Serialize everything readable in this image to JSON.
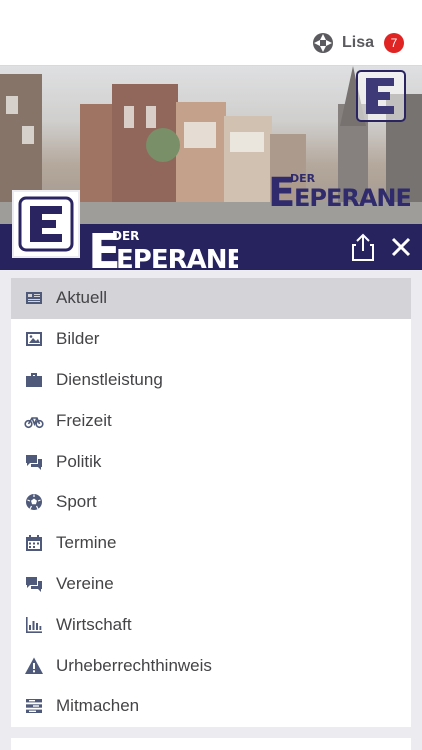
{
  "header": {
    "user_name": "Lisa",
    "notification_count": "7"
  },
  "brand": {
    "logo_letter": "E",
    "wordmark_small": "DER",
    "wordmark_big": "EPERANER",
    "primary_color": "#27235f"
  },
  "menu": {
    "items": [
      {
        "label": "Aktuell",
        "icon": "newspaper-icon"
      },
      {
        "label": "Bilder",
        "icon": "image-icon"
      },
      {
        "label": "Dienstleistung",
        "icon": "briefcase-icon"
      },
      {
        "label": "Freizeit",
        "icon": "bicycle-icon"
      },
      {
        "label": "Politik",
        "icon": "chat-icon"
      },
      {
        "label": "Sport",
        "icon": "soccer-ball-icon"
      },
      {
        "label": "Termine",
        "icon": "calendar-icon"
      },
      {
        "label": "Vereine",
        "icon": "chat-icon"
      },
      {
        "label": "Wirtschaft",
        "icon": "bar-chart-icon"
      },
      {
        "label": "Urheberrechthinweis",
        "icon": "warning-icon"
      },
      {
        "label": "Mitmachen",
        "icon": "list-icon"
      }
    ]
  }
}
